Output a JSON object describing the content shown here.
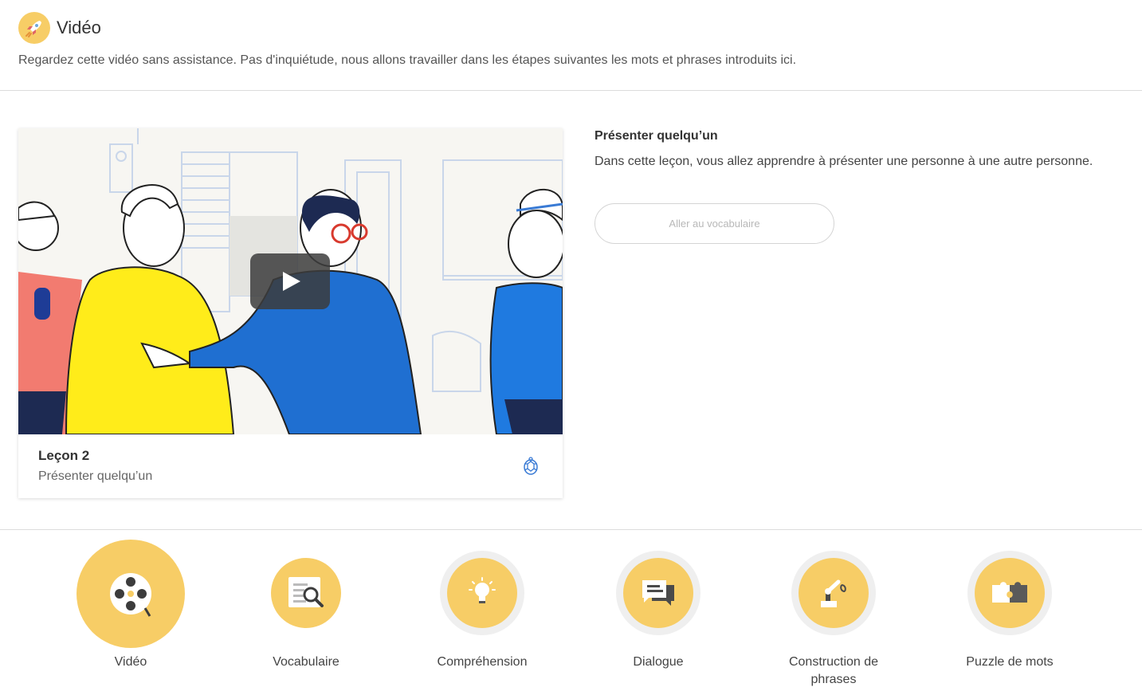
{
  "header": {
    "icon": "rocket-icon",
    "title": "Vidéo",
    "subtitle": "Regardez cette vidéo sans assistance. Pas d'inquiétude, nous allons travailler dans les étapes suivantes les mots et phrases introduits ici."
  },
  "video": {
    "play_icon": "play-icon",
    "lesson_title": "Leçon 2",
    "lesson_subtitle": "Présenter quelqu’un",
    "lesson_icon": "turtle-icon"
  },
  "info": {
    "title": "Présenter quelqu’un",
    "description": "Dans cette leçon, vous allez apprendre à présenter une personne à une autre personne.",
    "vocab_button": "Aller au vocabulaire"
  },
  "steps": [
    {
      "label": "Vidéo",
      "icon": "film-reel-icon",
      "active": true
    },
    {
      "label": "Vocabulaire",
      "icon": "magnifier-document-icon",
      "active": false
    },
    {
      "label": "Compréhension",
      "icon": "lightbulb-icon",
      "active": false
    },
    {
      "label": "Dialogue",
      "icon": "chat-bubbles-icon",
      "active": false
    },
    {
      "label": "Construction de phrases",
      "icon": "robot-arm-icon",
      "active": false
    },
    {
      "label": "Puzzle de mots",
      "icon": "puzzle-icon",
      "active": false
    }
  ],
  "colors": {
    "accent": "#f7cd66",
    "ring": "#efefef",
    "divider": "#dcdcdc",
    "link_icon": "#3a7bd5"
  }
}
